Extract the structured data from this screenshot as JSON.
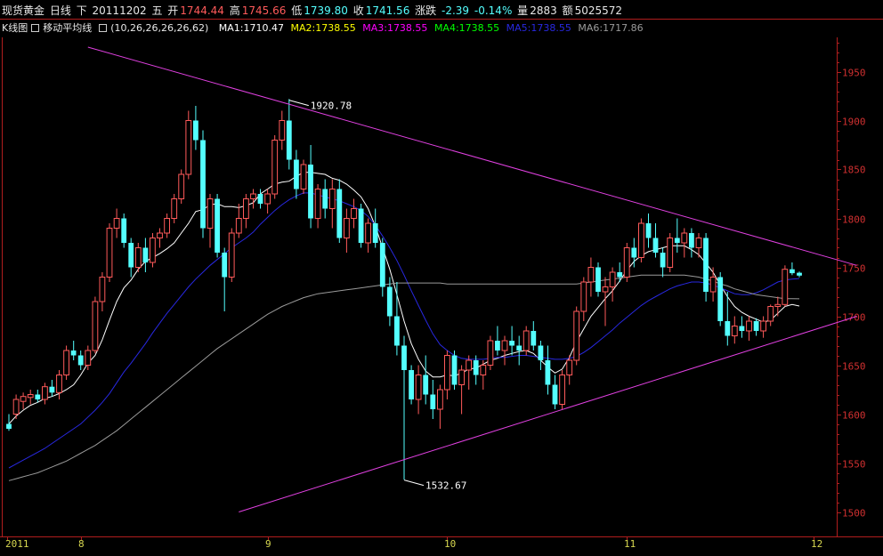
{
  "header": {
    "name": "现货黄金",
    "period": "日线",
    "direction": "下",
    "date": "20111202",
    "weekday": "五",
    "open_label": "开",
    "open": "1744.44",
    "high_label": "高",
    "high": "1745.66",
    "low_label": "低",
    "low": "1739.80",
    "close_label": "收",
    "close": "1741.56",
    "change_label": "涨跌",
    "change": "-2.39",
    "change_pct": "-0.14%",
    "volume_label": "量",
    "volume": "2883",
    "amount_label": "额",
    "amount": "5025572"
  },
  "indicator": {
    "tab_kline": "K线图",
    "tab_ma": "移动平均线",
    "params": "(10,26,26,26,26,62)",
    "ma1": "MA1:1710.47",
    "ma2": "MA2:1738.55",
    "ma3": "MA3:1738.55",
    "ma4": "MA4:1738.55",
    "ma5": "MA5:1738.55",
    "ma6": "MA6:1717.86"
  },
  "colors": {
    "background": "#000000",
    "up": "#ff5a5a",
    "down": "#54ffff",
    "axis": "#b01e1e",
    "trendline": "#e040e0",
    "ma1": "#ffffff",
    "ma2": "#ffff00",
    "ma3": "#ff00ff",
    "ma4": "#00ff00",
    "ma5": "#2828e0",
    "ma6": "#9a9a9a"
  },
  "chart_data": {
    "type": "candlestick",
    "y_ticks": [
      1500,
      1550,
      1600,
      1650,
      1700,
      1750,
      1800,
      1850,
      1900,
      1950
    ],
    "ylim": [
      1475,
      1985
    ],
    "x_labels": [
      {
        "label": "2011",
        "index": 0
      },
      {
        "label": "8",
        "index": 10
      },
      {
        "label": "9",
        "index": 36
      },
      {
        "label": "10",
        "index": 61
      },
      {
        "label": "11",
        "index": 86
      },
      {
        "label": "12",
        "index": 112
      }
    ],
    "annotations": [
      {
        "label": "1920.78",
        "index": 39,
        "value": 1920.78
      },
      {
        "label": "1532.67",
        "index": 55,
        "value": 1532.67
      }
    ],
    "trendlines": [
      {
        "from": [
          11,
          1975
        ],
        "to": [
          118,
          1752
        ]
      },
      {
        "from": [
          32,
          1500
        ],
        "to": [
          118,
          1700
        ]
      }
    ],
    "candles": [
      [
        1590,
        1600,
        1583,
        1585
      ],
      [
        1600,
        1620,
        1595,
        1615
      ],
      [
        1613,
        1622,
        1605,
        1618
      ],
      [
        1617,
        1625,
        1610,
        1620
      ],
      [
        1620,
        1625,
        1612,
        1615
      ],
      [
        1615,
        1632,
        1610,
        1628
      ],
      [
        1628,
        1635,
        1618,
        1622
      ],
      [
        1622,
        1645,
        1615,
        1640
      ],
      [
        1640,
        1670,
        1635,
        1665
      ],
      [
        1665,
        1675,
        1655,
        1660
      ],
      [
        1660,
        1665,
        1645,
        1650
      ],
      [
        1650,
        1670,
        1645,
        1665
      ],
      [
        1665,
        1720,
        1662,
        1715
      ],
      [
        1715,
        1745,
        1705,
        1740
      ],
      [
        1740,
        1795,
        1735,
        1790
      ],
      [
        1790,
        1810,
        1780,
        1800
      ],
      [
        1800,
        1805,
        1770,
        1775
      ],
      [
        1775,
        1780,
        1740,
        1750
      ],
      [
        1750,
        1775,
        1745,
        1770
      ],
      [
        1770,
        1780,
        1745,
        1755
      ],
      [
        1755,
        1785,
        1750,
        1780
      ],
      [
        1780,
        1790,
        1770,
        1785
      ],
      [
        1785,
        1805,
        1780,
        1800
      ],
      [
        1800,
        1825,
        1795,
        1820
      ],
      [
        1820,
        1850,
        1815,
        1845
      ],
      [
        1845,
        1910,
        1840,
        1900
      ],
      [
        1900,
        1915,
        1870,
        1880
      ],
      [
        1880,
        1890,
        1780,
        1790
      ],
      [
        1790,
        1825,
        1770,
        1820
      ],
      [
        1820,
        1825,
        1760,
        1765
      ],
      [
        1765,
        1770,
        1705,
        1740
      ],
      [
        1740,
        1790,
        1735,
        1785
      ],
      [
        1785,
        1815,
        1780,
        1800
      ],
      [
        1800,
        1825,
        1790,
        1820
      ],
      [
        1820,
        1830,
        1810,
        1825
      ],
      [
        1825,
        1830,
        1810,
        1815
      ],
      [
        1815,
        1830,
        1805,
        1825
      ],
      [
        1825,
        1885,
        1820,
        1880
      ],
      [
        1880,
        1910,
        1870,
        1900
      ],
      [
        1900,
        1922,
        1850,
        1860
      ],
      [
        1860,
        1870,
        1820,
        1830
      ],
      [
        1830,
        1860,
        1825,
        1855
      ],
      [
        1855,
        1875,
        1790,
        1800
      ],
      [
        1800,
        1835,
        1790,
        1830
      ],
      [
        1830,
        1840,
        1800,
        1810
      ],
      [
        1810,
        1840,
        1790,
        1830
      ],
      [
        1830,
        1840,
        1775,
        1780
      ],
      [
        1780,
        1810,
        1765,
        1800
      ],
      [
        1800,
        1820,
        1790,
        1810
      ],
      [
        1810,
        1815,
        1770,
        1775
      ],
      [
        1775,
        1800,
        1765,
        1795
      ],
      [
        1795,
        1810,
        1770,
        1775
      ],
      [
        1775,
        1780,
        1720,
        1730
      ],
      [
        1730,
        1740,
        1690,
        1700
      ],
      [
        1700,
        1735,
        1660,
        1670
      ],
      [
        1670,
        1680,
        1533,
        1645
      ],
      [
        1645,
        1650,
        1610,
        1615
      ],
      [
        1615,
        1650,
        1600,
        1640
      ],
      [
        1640,
        1660,
        1610,
        1620
      ],
      [
        1620,
        1635,
        1595,
        1605
      ],
      [
        1605,
        1630,
        1585,
        1625
      ],
      [
        1625,
        1665,
        1615,
        1660
      ],
      [
        1660,
        1665,
        1625,
        1630
      ],
      [
        1630,
        1650,
        1600,
        1645
      ],
      [
        1645,
        1660,
        1625,
        1655
      ],
      [
        1655,
        1660,
        1630,
        1640
      ],
      [
        1640,
        1655,
        1625,
        1650
      ],
      [
        1650,
        1680,
        1645,
        1675
      ],
      [
        1675,
        1690,
        1660,
        1665
      ],
      [
        1665,
        1680,
        1650,
        1675
      ],
      [
        1675,
        1690,
        1660,
        1670
      ],
      [
        1670,
        1680,
        1650,
        1665
      ],
      [
        1665,
        1690,
        1660,
        1685
      ],
      [
        1685,
        1695,
        1665,
        1670
      ],
      [
        1670,
        1675,
        1645,
        1655
      ],
      [
        1655,
        1670,
        1620,
        1630
      ],
      [
        1630,
        1640,
        1605,
        1610
      ],
      [
        1610,
        1645,
        1605,
        1640
      ],
      [
        1640,
        1660,
        1630,
        1655
      ],
      [
        1655,
        1710,
        1650,
        1705
      ],
      [
        1705,
        1740,
        1695,
        1735
      ],
      [
        1735,
        1760,
        1720,
        1750
      ],
      [
        1750,
        1755,
        1720,
        1725
      ],
      [
        1725,
        1740,
        1690,
        1730
      ],
      [
        1730,
        1750,
        1715,
        1745
      ],
      [
        1745,
        1755,
        1735,
        1740
      ],
      [
        1740,
        1775,
        1735,
        1770
      ],
      [
        1770,
        1780,
        1750,
        1760
      ],
      [
        1760,
        1800,
        1755,
        1795
      ],
      [
        1795,
        1805,
        1770,
        1780
      ],
      [
        1780,
        1795,
        1760,
        1765
      ],
      [
        1765,
        1770,
        1740,
        1750
      ],
      [
        1750,
        1785,
        1745,
        1780
      ],
      [
        1780,
        1800,
        1765,
        1775
      ],
      [
        1775,
        1790,
        1760,
        1785
      ],
      [
        1785,
        1790,
        1760,
        1770
      ],
      [
        1770,
        1785,
        1760,
        1780
      ],
      [
        1780,
        1785,
        1715,
        1725
      ],
      [
        1725,
        1750,
        1715,
        1740
      ],
      [
        1740,
        1745,
        1690,
        1695
      ],
      [
        1695,
        1725,
        1670,
        1680
      ],
      [
        1680,
        1700,
        1672,
        1690
      ],
      [
        1690,
        1700,
        1678,
        1685
      ],
      [
        1685,
        1700,
        1675,
        1695
      ],
      [
        1695,
        1698,
        1680,
        1685
      ],
      [
        1685,
        1700,
        1678,
        1695
      ],
      [
        1695,
        1712,
        1690,
        1710
      ],
      [
        1710,
        1720,
        1700,
        1712
      ],
      [
        1712,
        1752,
        1710,
        1748
      ],
      [
        1748,
        1755,
        1742,
        1744
      ],
      [
        1744.44,
        1745.66,
        1739.8,
        1741.56
      ]
    ],
    "ma_lines": [
      {
        "name": "MA1",
        "values": [
          1590,
          1598,
          1604,
          1609,
          1612,
          1616,
          1618,
          1621,
          1625,
          1630,
          1640,
          1652,
          1660,
          1676,
          1696,
          1715,
          1729,
          1737,
          1748,
          1756,
          1760,
          1764,
          1769,
          1775,
          1785,
          1795,
          1807,
          1809,
          1814,
          1815,
          1812,
          1812,
          1811,
          1813,
          1816,
          1825,
          1830,
          1835,
          1837,
          1838,
          1843,
          1847,
          1847,
          1846,
          1845,
          1841,
          1839,
          1835,
          1829,
          1822,
          1810,
          1792,
          1770,
          1748,
          1722,
          1695,
          1672,
          1656,
          1644,
          1638,
          1638,
          1640,
          1639,
          1642,
          1646,
          1647,
          1651,
          1655,
          1657,
          1660,
          1662,
          1664,
          1665,
          1662,
          1655,
          1648,
          1642,
          1646,
          1658,
          1674,
          1687,
          1700,
          1709,
          1718,
          1726,
          1736,
          1747,
          1756,
          1762,
          1766,
          1768,
          1770,
          1772,
          1772,
          1772,
          1768,
          1763,
          1754,
          1745,
          1732,
          1720,
          1710,
          1704,
          1700,
          1697,
          1694,
          1696,
          1703,
          1710,
          1712,
          1710.47
        ]
      },
      {
        "name": "MA5",
        "values": [
          1545,
          1549,
          1553,
          1557,
          1561,
          1565,
          1570,
          1575,
          1580,
          1585,
          1590,
          1597,
          1604,
          1612,
          1621,
          1632,
          1643,
          1652,
          1662,
          1672,
          1683,
          1693,
          1703,
          1712,
          1721,
          1730,
          1738,
          1745,
          1752,
          1758,
          1764,
          1770,
          1775,
          1780,
          1786,
          1794,
          1801,
          1808,
          1814,
          1819,
          1823,
          1826,
          1826,
          1824,
          1822,
          1820,
          1818,
          1815,
          1812,
          1808,
          1802,
          1793,
          1782,
          1770,
          1757,
          1742,
          1726,
          1711,
          1696,
          1682,
          1671,
          1665,
          1660,
          1657,
          1656,
          1656,
          1656,
          1657,
          1658,
          1658,
          1659,
          1660,
          1660,
          1659,
          1658,
          1657,
          1656,
          1656,
          1657,
          1659,
          1663,
          1668,
          1674,
          1680,
          1686,
          1693,
          1699,
          1705,
          1711,
          1716,
          1720,
          1724,
          1728,
          1731,
          1733,
          1735,
          1735,
          1734,
          1732,
          1729,
          1726,
          1723,
          1722,
          1722,
          1724,
          1727,
          1731,
          1735,
          1737,
          1738,
          1738.55
        ]
      },
      {
        "name": "MA6",
        "values": [
          1532,
          1534,
          1536,
          1538,
          1540,
          1543,
          1546,
          1549,
          1552,
          1556,
          1560,
          1564,
          1568,
          1573,
          1578,
          1583,
          1589,
          1595,
          1601,
          1607,
          1613,
          1619,
          1625,
          1631,
          1637,
          1643,
          1649,
          1655,
          1661,
          1667,
          1672,
          1677,
          1682,
          1687,
          1692,
          1697,
          1702,
          1706,
          1710,
          1713,
          1716,
          1719,
          1721,
          1723,
          1724,
          1725,
          1726,
          1727,
          1728,
          1729,
          1730,
          1731,
          1732,
          1733,
          1734,
          1734,
          1734,
          1734,
          1734,
          1734,
          1734,
          1733,
          1733,
          1733,
          1733,
          1733,
          1733,
          1733,
          1733,
          1733,
          1733,
          1733,
          1733,
          1733,
          1733,
          1733,
          1733,
          1733,
          1733,
          1733,
          1734,
          1735,
          1736,
          1737,
          1738,
          1739,
          1740,
          1741,
          1742,
          1742,
          1742,
          1742,
          1742,
          1742,
          1742,
          1741,
          1740,
          1738,
          1736,
          1733,
          1731,
          1728,
          1726,
          1724,
          1722,
          1721,
          1720,
          1719,
          1718,
          1718,
          1717.86
        ]
      }
    ]
  }
}
